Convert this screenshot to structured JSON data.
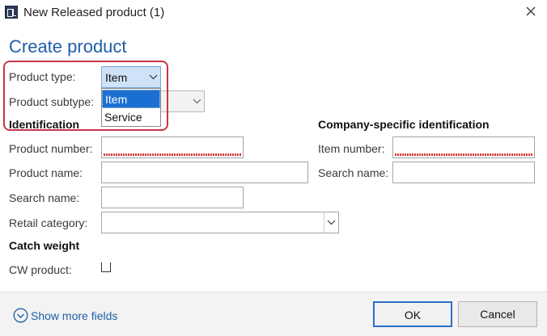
{
  "window": {
    "title": "New Released product (1)",
    "app_icon": "dynamics-ax-icon",
    "close_icon": "close-icon"
  },
  "form": {
    "heading": "Create product",
    "product_type": {
      "label": "Product type:",
      "value": "Item",
      "options": [
        "Item",
        "Service"
      ],
      "selected": "Item"
    },
    "product_subtype": {
      "label": "Product subtype:",
      "value": ""
    },
    "identification": {
      "title": "Identification",
      "product_number": {
        "label": "Product number:",
        "value": ""
      },
      "product_name": {
        "label": "Product name:",
        "value": ""
      },
      "search_name": {
        "label": "Search name:",
        "value": ""
      },
      "retail_category": {
        "label": "Retail category:",
        "value": ""
      }
    },
    "company_identification": {
      "title": "Company-specific identification",
      "item_number": {
        "label": "Item number:",
        "value": ""
      },
      "search_name": {
        "label": "Search name:",
        "value": ""
      }
    },
    "catch_weight": {
      "title": "Catch weight",
      "cw_product": {
        "label": "CW product:",
        "checked": false
      }
    }
  },
  "footer": {
    "show_more": "Show more fields",
    "ok": "OK",
    "cancel": "Cancel"
  },
  "colors": {
    "accent": "#1f5fa8",
    "highlight_border": "#c8344a",
    "selection": "#1c6fd2"
  }
}
